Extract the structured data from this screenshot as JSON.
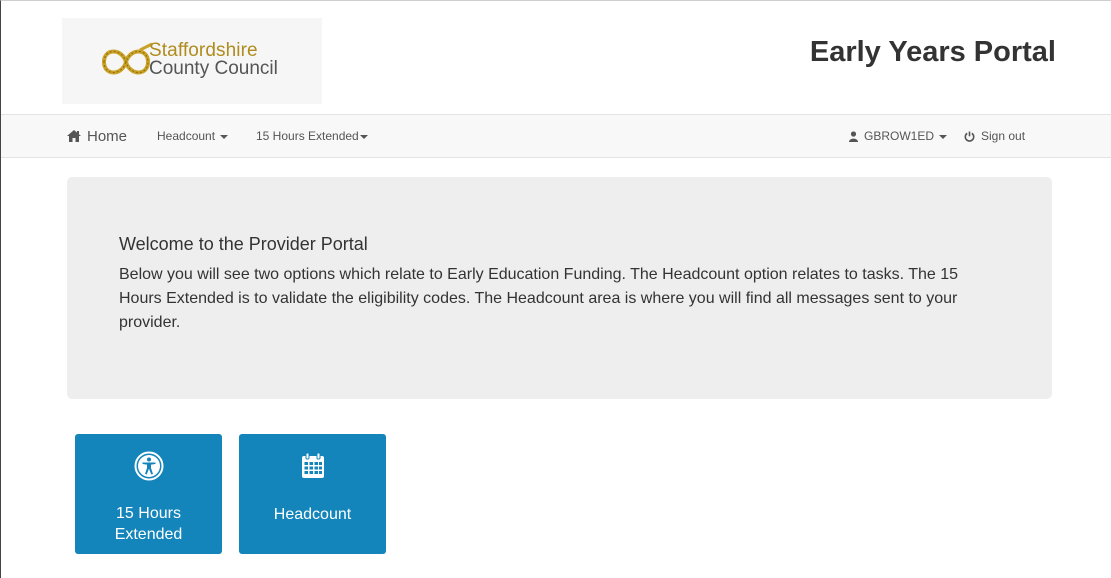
{
  "header": {
    "logo_line1": "Staffordshire",
    "logo_line2": "County Council",
    "portal_title": "Early Years Portal"
  },
  "nav": {
    "home_label": "Home",
    "headcount_label": "Headcount",
    "extended_label": "15 Hours Extended",
    "user_label": "GBROW1ED",
    "signout_label": "Sign out"
  },
  "welcome": {
    "title": "Welcome to the Provider Portal",
    "text": "Below you will see two options which relate to Early Education Funding. The Headcount option relates to tasks. The 15 Hours Extended is to validate the eligibility codes. The Headcount area is where you will find all messages sent to your provider."
  },
  "tiles": [
    {
      "line1": "15 Hours",
      "line2": "Extended",
      "icon": "accessibility-icon"
    },
    {
      "line1": "Headcount",
      "icon": "calendar-icon"
    }
  ],
  "colors": {
    "tile_blue": "#1385bb",
    "logo_gold": "#b08c1e",
    "navbar_bg": "#f8f8f8",
    "jumbotron_bg": "#eeeeee"
  }
}
